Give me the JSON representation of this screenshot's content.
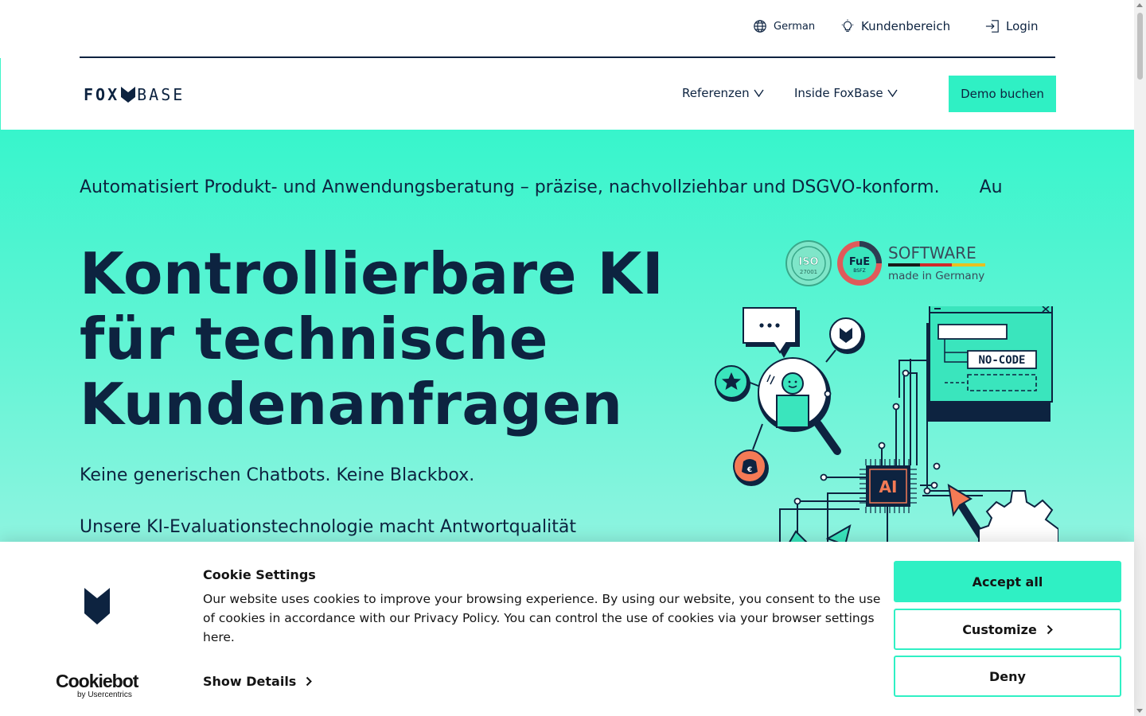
{
  "topbar": {
    "language": "German",
    "customer_area": "Kundenbereich",
    "login": "Login"
  },
  "nav": {
    "logo_left": "FOX",
    "logo_right": "BASE",
    "items": [
      {
        "label": "Referenzen"
      },
      {
        "label": "Inside FoxBase"
      }
    ],
    "cta": "Demo buchen"
  },
  "hero": {
    "ticker": "Automatisiert Produkt- und Anwendungsberatung –  präzise, nachvollziehbar und DSGVO-konform.",
    "ticker_next": "Au",
    "headline": [
      "Kontrollierbare KI",
      "für technische",
      "Kundenanfragen"
    ],
    "subline_1": "Keine generischen Chatbots. Keine Blackbox.",
    "subline_2": "Unsere KI-Evaluationstechnologie macht Antwortqualität",
    "badge_iso": "ISO",
    "badge_iso_number": "27001",
    "badge_fue": "FuE",
    "badge_bsfz": "BSFZ",
    "badge_software": "SOFTWARE",
    "badge_made": "made in Germany",
    "illus_nocode": "NO-CODE",
    "illus_ai": "AI",
    "illus_euro": "€"
  },
  "cookie": {
    "title": "Cookie Settings",
    "text": "Our website uses cookies to improve your browsing experience. By using our website, you consent to the use of cookies in accordance with our Privacy Policy. You can control the use of cookies via your browser settings here.",
    "show_details": "Show Details",
    "accept": "Accept all",
    "customize": "Customize",
    "deny": "Deny",
    "brand": "Cookiebot",
    "brand_by": "by Usercentrics"
  },
  "colors": {
    "accent": "#2ff0c4",
    "navy": "#0d2340",
    "orange": "#f47a55"
  }
}
